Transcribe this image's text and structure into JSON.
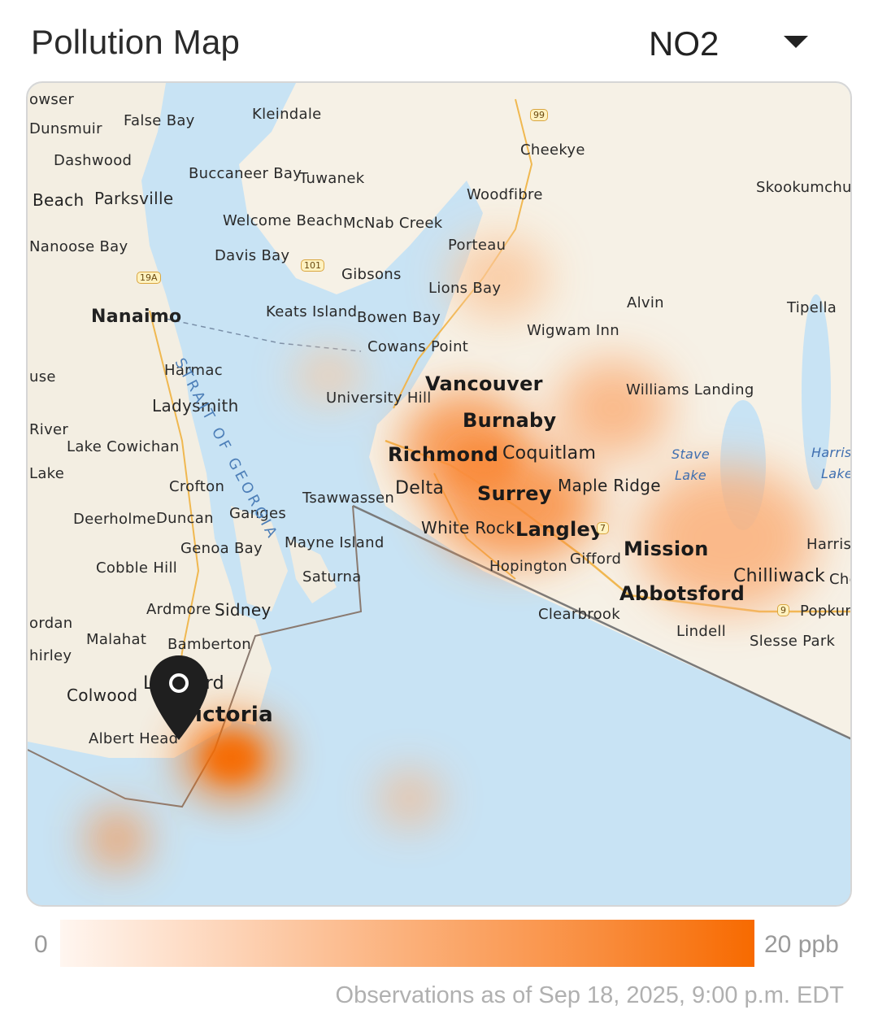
{
  "header": {
    "title": "Pollution Map",
    "pollutant": "NO2"
  },
  "map": {
    "marker_label": "location-pin",
    "places": [
      {
        "name": "owser",
        "kind": "town"
      },
      {
        "name": "Dunsmuir",
        "kind": "town"
      },
      {
        "name": "False Bay",
        "kind": "town"
      },
      {
        "name": "Kleindale",
        "kind": "town"
      },
      {
        "name": "Dashwood",
        "kind": "town"
      },
      {
        "name": "Cheekye",
        "kind": "town"
      },
      {
        "name": "Buccaneer Bay",
        "kind": "town"
      },
      {
        "name": "Tuwanek",
        "kind": "town"
      },
      {
        "name": "Beach",
        "kind": "town"
      },
      {
        "name": "Parksville",
        "kind": "city"
      },
      {
        "name": "Woodfibre",
        "kind": "town"
      },
      {
        "name": "Skookumchuc",
        "kind": "town"
      },
      {
        "name": "Welcome Beach",
        "kind": "town"
      },
      {
        "name": "McNab Creek",
        "kind": "town"
      },
      {
        "name": "Nanoose Bay",
        "kind": "town"
      },
      {
        "name": "Porteau",
        "kind": "town"
      },
      {
        "name": "Davis Bay",
        "kind": "town"
      },
      {
        "name": "Gibsons",
        "kind": "town"
      },
      {
        "name": "Lions Bay",
        "kind": "town"
      },
      {
        "name": "Nanaimo",
        "kind": "city"
      },
      {
        "name": "Keats Island",
        "kind": "town"
      },
      {
        "name": "Bowen Bay",
        "kind": "town"
      },
      {
        "name": "Alvin",
        "kind": "town"
      },
      {
        "name": "Tipella",
        "kind": "town"
      },
      {
        "name": "Wigwam Inn",
        "kind": "town"
      },
      {
        "name": "Cowans Point",
        "kind": "town"
      },
      {
        "name": "Harmac",
        "kind": "town"
      },
      {
        "name": "Vancouver",
        "kind": "big"
      },
      {
        "name": "Williams Landing",
        "kind": "town"
      },
      {
        "name": "use",
        "kind": "town"
      },
      {
        "name": "University Hill",
        "kind": "town"
      },
      {
        "name": "Ladysmith",
        "kind": "city"
      },
      {
        "name": "Burnaby",
        "kind": "big"
      },
      {
        "name": "River",
        "kind": "town"
      },
      {
        "name": "Lake Cowichan",
        "kind": "town"
      },
      {
        "name": "Richmond",
        "kind": "big"
      },
      {
        "name": "Coquitlam",
        "kind": "city"
      },
      {
        "name": "Stave",
        "kind": "water"
      },
      {
        "name": "Lake",
        "kind": "water"
      },
      {
        "name": "Harrisc",
        "kind": "water"
      },
      {
        "name": "Lake",
        "kind": "water"
      },
      {
        "name": "Lake",
        "kind": "town"
      },
      {
        "name": "Crofton",
        "kind": "town"
      },
      {
        "name": "Delta",
        "kind": "city"
      },
      {
        "name": "Surrey",
        "kind": "big"
      },
      {
        "name": "Maple Ridge",
        "kind": "city"
      },
      {
        "name": "Tsawwassen",
        "kind": "town"
      },
      {
        "name": "Ganges",
        "kind": "town"
      },
      {
        "name": "Deerholme",
        "kind": "town"
      },
      {
        "name": "Duncan",
        "kind": "town"
      },
      {
        "name": "White Rock",
        "kind": "city"
      },
      {
        "name": "Langley",
        "kind": "big"
      },
      {
        "name": "Genoa Bay",
        "kind": "town"
      },
      {
        "name": "Mayne Island",
        "kind": "town"
      },
      {
        "name": "Mission",
        "kind": "big"
      },
      {
        "name": "Harrisc",
        "kind": "town"
      },
      {
        "name": "Gifford",
        "kind": "town"
      },
      {
        "name": "Cobble Hill",
        "kind": "town"
      },
      {
        "name": "Hopington",
        "kind": "town"
      },
      {
        "name": "Saturna",
        "kind": "town"
      },
      {
        "name": "Chilliwack",
        "kind": "city"
      },
      {
        "name": "Che",
        "kind": "town"
      },
      {
        "name": "Abbotsford",
        "kind": "big"
      },
      {
        "name": "Ardmore",
        "kind": "town"
      },
      {
        "name": "Sidney",
        "kind": "city"
      },
      {
        "name": "Clearbrook",
        "kind": "town"
      },
      {
        "name": "Popkum",
        "kind": "town"
      },
      {
        "name": "ordan",
        "kind": "town"
      },
      {
        "name": "Lindell",
        "kind": "town"
      },
      {
        "name": "Malahat",
        "kind": "town"
      },
      {
        "name": "Bamberton",
        "kind": "town"
      },
      {
        "name": "Slesse Park",
        "kind": "town"
      },
      {
        "name": "hirley",
        "kind": "town"
      },
      {
        "name": "Langford",
        "kind": "city"
      },
      {
        "name": "Colwood",
        "kind": "city"
      },
      {
        "name": "Victoria",
        "kind": "big"
      },
      {
        "name": "Albert Head",
        "kind": "town"
      }
    ],
    "strait_label": "STRAIT OF GEORGIA",
    "highway_shields": [
      "99",
      "101",
      "19A",
      "7",
      "9"
    ],
    "heat_color": "#f76a00",
    "water_color": "#c8e3f4",
    "land_color": "#f6f1e6"
  },
  "legend": {
    "min_label": "0",
    "max_label": "20 ppb",
    "color_low": "#fff6f0",
    "color_high": "#f76a00"
  },
  "footer": {
    "timestamp": "Observations as of Sep 18, 2025, 9:00 p.m. EDT"
  }
}
